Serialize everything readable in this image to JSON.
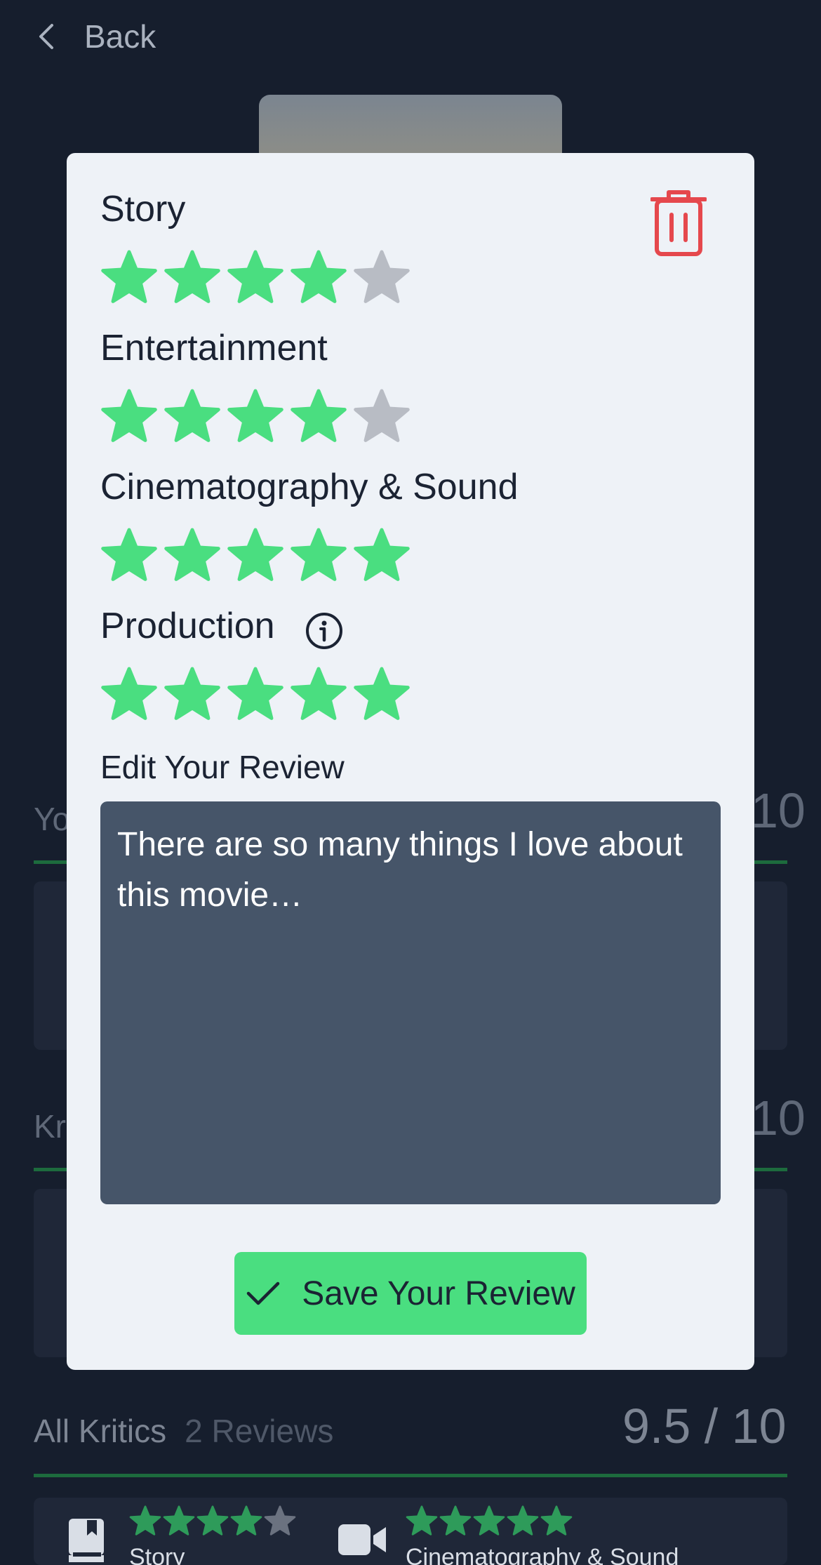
{
  "nav": {
    "back_label": "Back"
  },
  "background": {
    "your_section_label": "Yo",
    "your_section_score": "10",
    "kritics_section_label": "Kr",
    "kritics_section_score": "10",
    "all_kritics": {
      "title": "All Kritics",
      "count": "2 Reviews",
      "score": "9.5 / 10"
    },
    "summary_row": [
      {
        "icon": "book-icon",
        "label": "Story",
        "rating": 4
      },
      {
        "icon": "video-camera-icon",
        "label": "Cinematography & Sound",
        "rating": 5
      }
    ]
  },
  "modal": {
    "categories": [
      {
        "label": "Story",
        "rating": 4,
        "max": 5
      },
      {
        "label": "Entertainment",
        "rating": 4,
        "max": 5
      },
      {
        "label": "Cinematography & Sound",
        "rating": 5,
        "max": 5
      },
      {
        "label": "Production",
        "rating": 5,
        "max": 5,
        "info_icon": "info-icon"
      }
    ],
    "edit_label": "Edit Your Review",
    "review_text": "There are so many things I love about this movie…",
    "save_label": "Save Your Review",
    "delete_icon": "trash-icon"
  },
  "colors": {
    "star_filled": "#4ade80",
    "star_empty": "#b8bcc4",
    "delete": "#e5484d",
    "save_button": "#4ade80",
    "background": "#161e2d",
    "modal": "#eef2f7",
    "input": "#465569"
  }
}
